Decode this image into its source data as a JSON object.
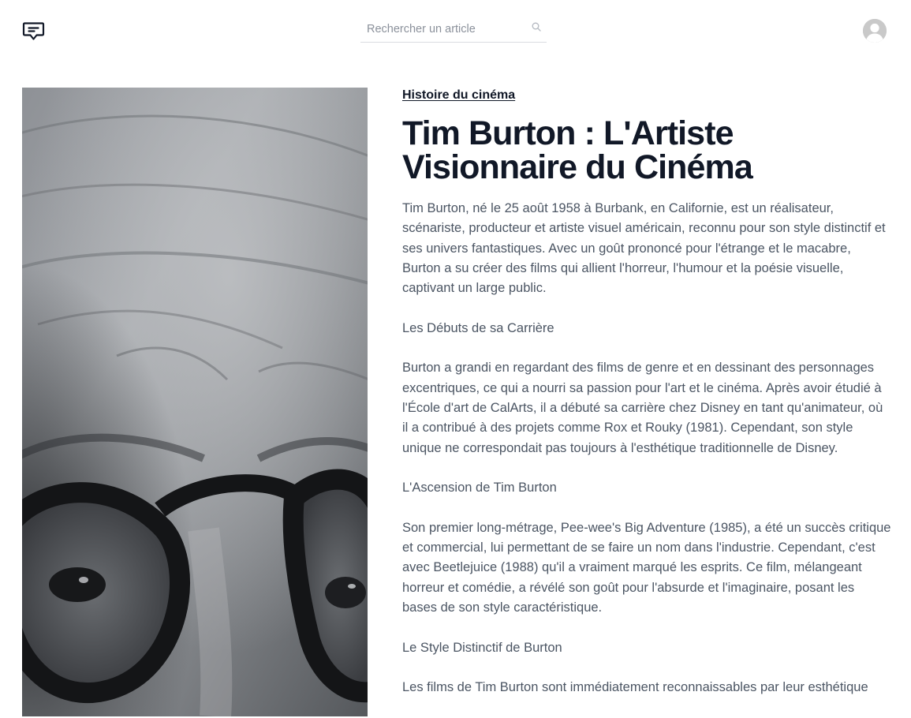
{
  "header": {
    "logo_icon": "chat-bubble-icon",
    "search": {
      "placeholder": "Rechercher un article",
      "value": "",
      "icon": "search-icon"
    },
    "avatar_icon": "user-avatar-icon"
  },
  "hero": {
    "image": "black-and-white close-up portrait, eyes with round glasses"
  },
  "article": {
    "category": "Histoire du cinéma",
    "title": "Tim Burton : L'Artiste Visionnaire du Cinéma",
    "paragraphs": [
      "Tim Burton, né le 25 août 1958 à Burbank, en Californie, est un réalisateur, scénariste, producteur et artiste visuel américain, reconnu pour son style distinctif et ses univers fantastiques. Avec un goût prononcé pour l'étrange et le macabre, Burton a su créer des films qui allient l'horreur, l'humour et la poésie visuelle, captivant un large public.",
      "Les Débuts de sa Carrière",
      "Burton a grandi en regardant des films de genre et en dessinant des personnages excentriques, ce qui a nourri sa passion pour l'art et le cinéma. Après avoir étudié à l'École d'art de CalArts, il a débuté sa carrière chez Disney en tant qu'animateur, où il a contribué à des projets comme Rox et Rouky (1981). Cependant, son style unique ne correspondait pas toujours à l'esthétique traditionnelle de Disney.",
      "L'Ascension de Tim Burton",
      "Son premier long-métrage, Pee-wee's Big Adventure (1985), a été un succès critique et commercial, lui permettant de se faire un nom dans l'industrie. Cependant, c'est avec Beetlejuice (1988) qu'il a vraiment marqué les esprits. Ce film, mélangeant horreur et comédie, a révélé son goût pour l'absurde et l'imaginaire, posant les bases de son style caractéristique.",
      "Le Style Distinctif de Burton",
      "Les films de Tim Burton sont immédiatement reconnaissables par leur esthétique"
    ]
  },
  "colors": {
    "title": "#111827",
    "body_text": "#4b5563",
    "placeholder": "#8b919b",
    "divider": "#d9dce1"
  }
}
